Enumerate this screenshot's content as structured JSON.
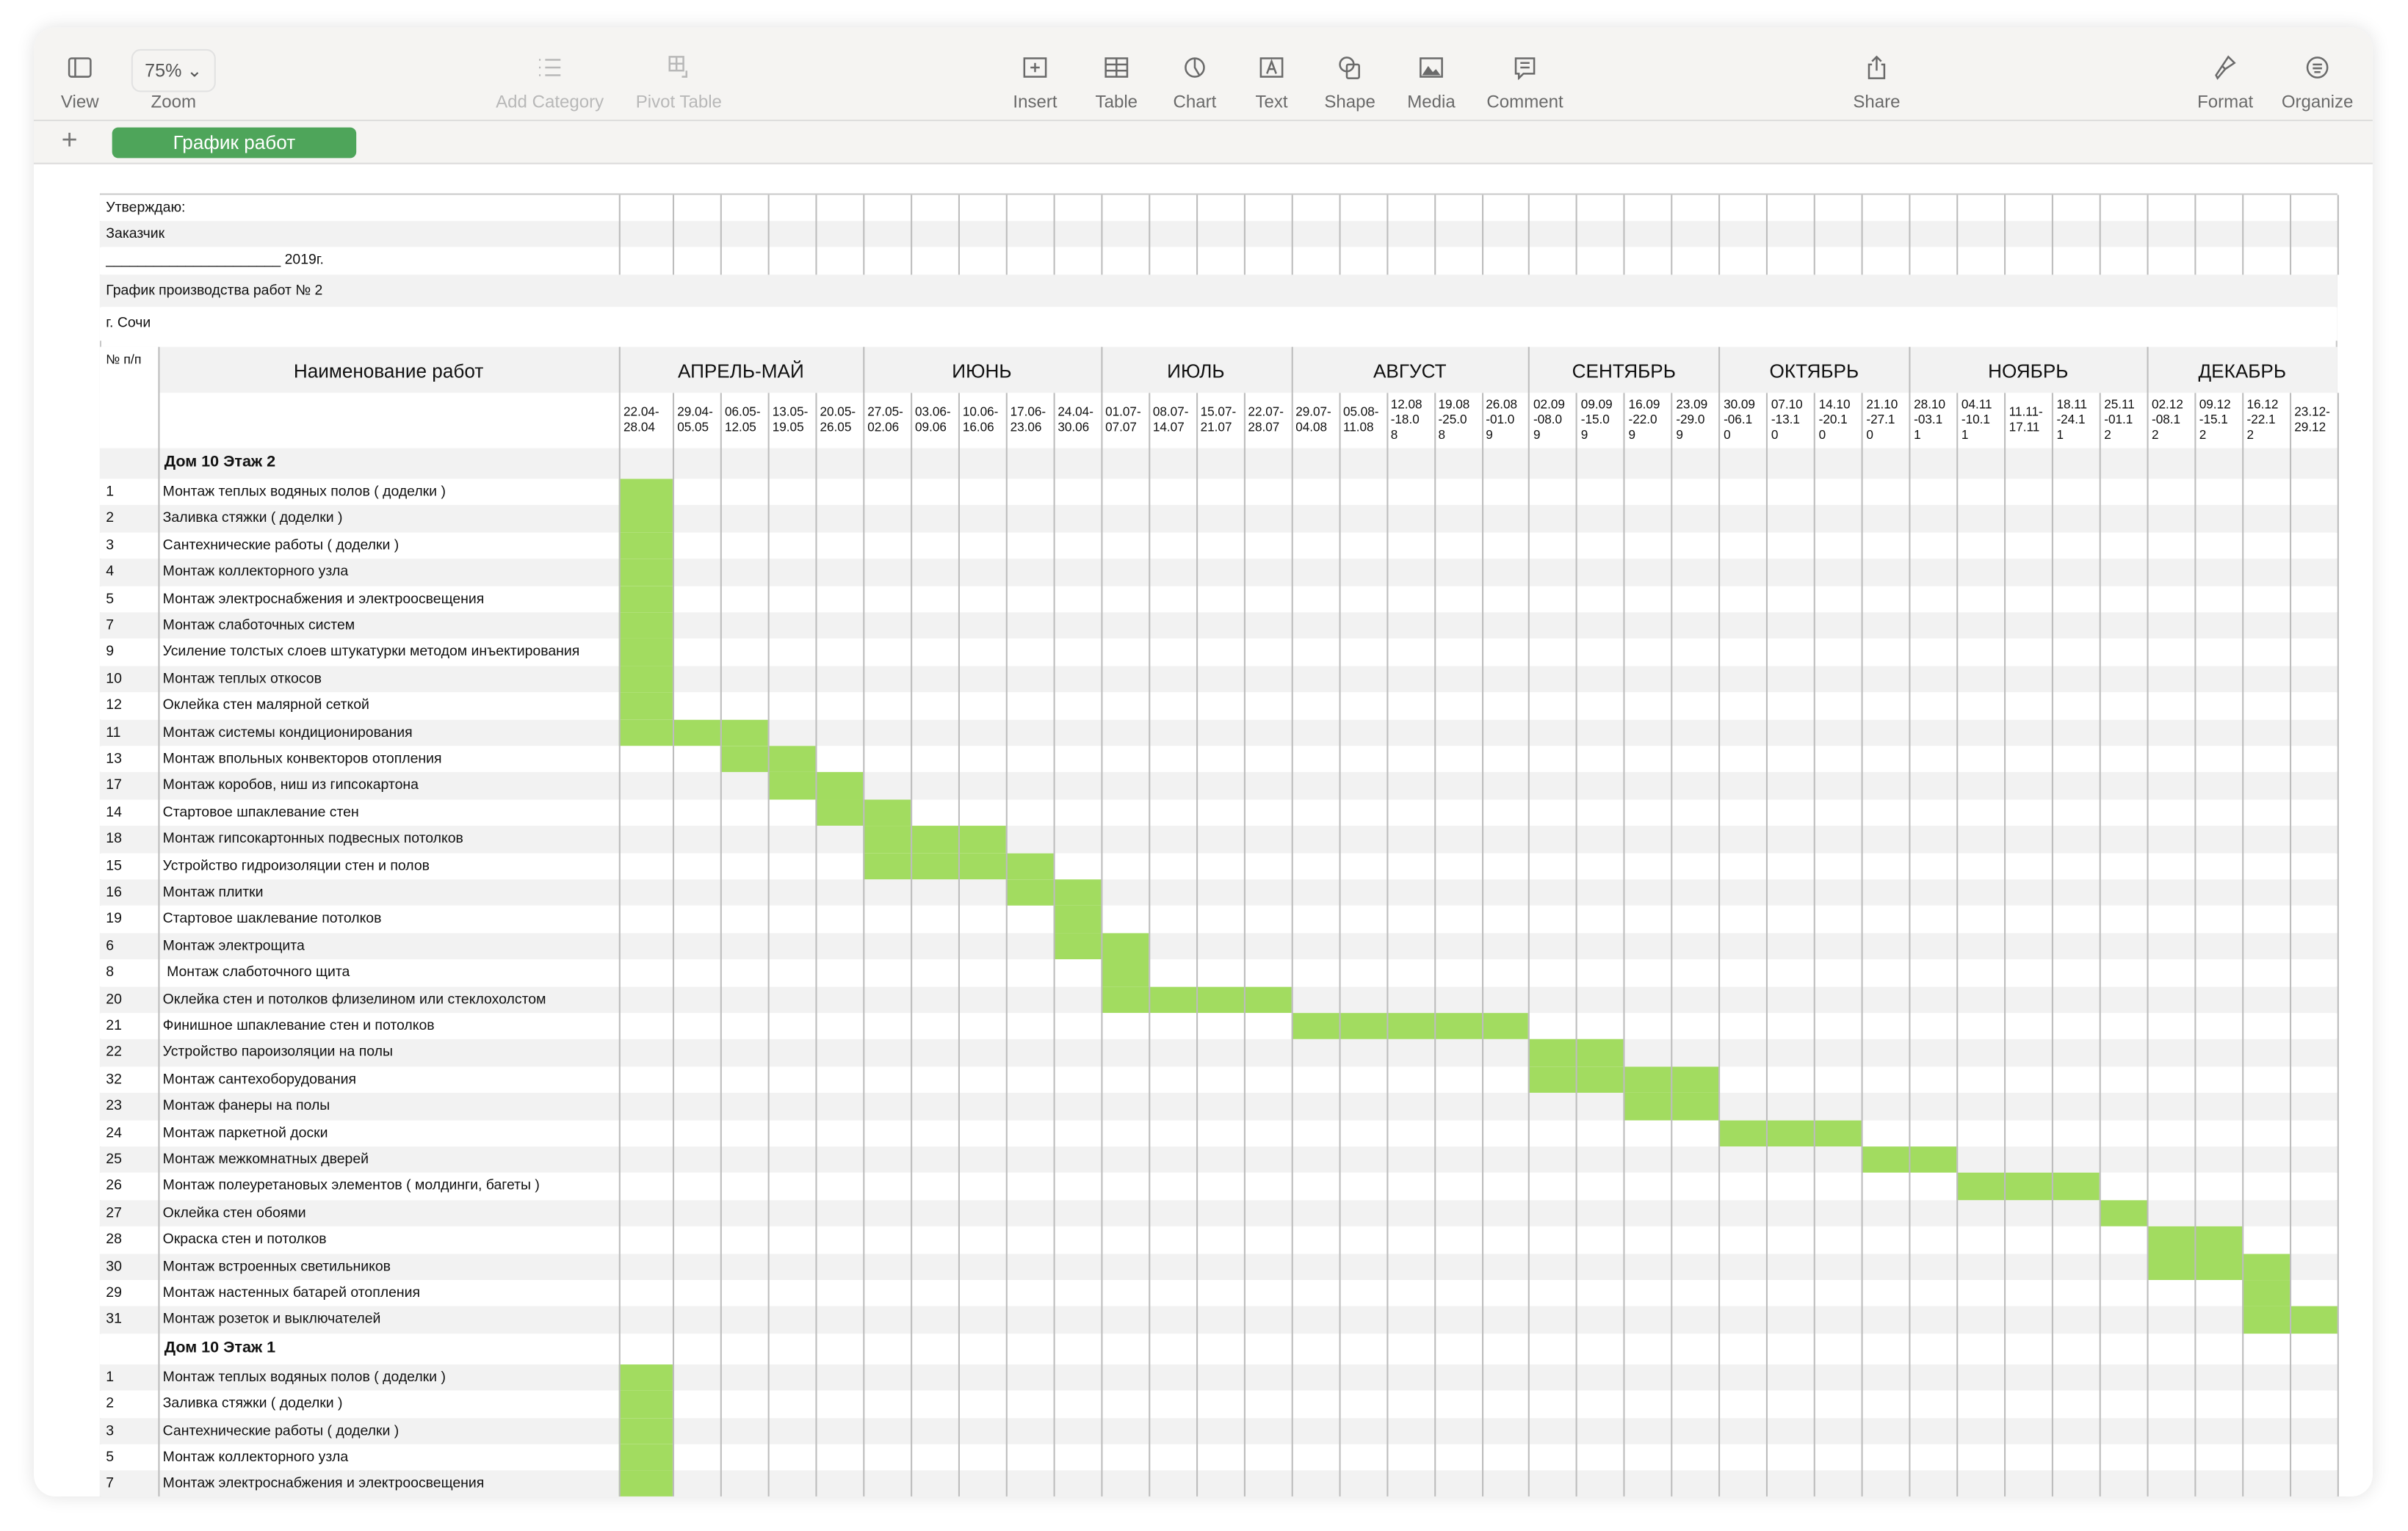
{
  "toolbar": {
    "zoom_value": "75%",
    "items": [
      {
        "label": "View",
        "icon": "sidebar-icon",
        "disabled": false
      },
      {
        "label": "Zoom",
        "icon": "zoom-menu",
        "disabled": false
      },
      {
        "label": "Add Category",
        "icon": "list-icon",
        "disabled": true
      },
      {
        "label": "Pivot Table",
        "icon": "pivot-table-icon",
        "disabled": true
      },
      {
        "label": "Insert",
        "icon": "insert-icon",
        "disabled": false
      },
      {
        "label": "Table",
        "icon": "table-icon",
        "disabled": false
      },
      {
        "label": "Chart",
        "icon": "chart-icon",
        "disabled": false
      },
      {
        "label": "Text",
        "icon": "text-icon",
        "disabled": false
      },
      {
        "label": "Shape",
        "icon": "shape-icon",
        "disabled": false
      },
      {
        "label": "Media",
        "icon": "media-icon",
        "disabled": false
      },
      {
        "label": "Comment",
        "icon": "comment-icon",
        "disabled": false
      },
      {
        "label": "Share",
        "icon": "share-icon",
        "disabled": false
      },
      {
        "label": "Format",
        "icon": "format-brush-icon",
        "disabled": false
      },
      {
        "label": "Organize",
        "icon": "organize-icon",
        "disabled": false
      }
    ]
  },
  "sheet_tab": "График работ",
  "add_sheet": "+",
  "colors": {
    "bar": "#a2dc60",
    "tab": "#4ea55a",
    "stripe": "#f2f2f2"
  },
  "doc": {
    "approve": "Утверждаю:",
    "customer": "Заказчик",
    "date_line": "______________________ 2019г.",
    "title": "График производства работ № 2",
    "city": "г. Сочи"
  },
  "table": {
    "col_no": "№ п/п",
    "col_name": "Наименование работ",
    "months": [
      {
        "name": "АПРЕЛЬ-МАЙ",
        "weeks": 5
      },
      {
        "name": "ИЮНЬ",
        "weeks": 5
      },
      {
        "name": "ИЮЛЬ",
        "weeks": 4
      },
      {
        "name": "АВГУСТ",
        "weeks": 5
      },
      {
        "name": "СЕНТЯБРЬ",
        "weeks": 4
      },
      {
        "name": "ОКТЯБРЬ",
        "weeks": 4
      },
      {
        "name": "НОЯБРЬ",
        "weeks": 5
      },
      {
        "name": "ДЕКАБРЬ",
        "weeks": 4
      }
    ],
    "weeks": [
      "22.04-\n28.04",
      "29.04-\n05.05",
      "06.05-\n12.05",
      "13.05-\n19.05",
      "20.05-\n26.05",
      "27.05-\n02.06",
      "03.06-\n09.06",
      "10.06-\n16.06",
      "17.06-\n23.06",
      "24.04-\n30.06",
      "01.07-\n07.07",
      "08.07-\n14.07",
      "15.07-\n21.07",
      "22.07-\n28.07",
      "29.07-\n04.08",
      "05.08-\n11.08",
      "12.08\n-18.0\n8",
      "19.08\n-25.0\n8",
      "26.08\n-01.0\n9",
      "02.09\n-08.0\n9",
      "09.09\n-15.0\n9",
      "16.09\n-22.0\n9",
      "23.09\n-29.0\n9",
      "30.09\n-06.1\n0",
      "07.10\n-13.1\n0",
      "14.10\n-20.1\n0",
      "21.10\n-27.1\n0",
      "28.10\n-03.1\n1",
      "04.11\n-10.1\n1",
      "11.11-\n17.11",
      "18.11\n-24.1\n1",
      "25.11\n-01.1\n2",
      "02.12\n-08.1\n2",
      "09.12\n-15.1\n2",
      "16.12\n-22.1\n2",
      "23.12-\n29.12"
    ],
    "sections": [
      {
        "title": "Дом 10 Этаж 2",
        "rows": [
          {
            "no": "1",
            "name": "Монтаж теплых водяных полов ( доделки )",
            "weeks": [
              0,
              0
            ]
          },
          {
            "no": "2",
            "name": "Заливка стяжки ( доделки )",
            "weeks": [
              0,
              0
            ]
          },
          {
            "no": "3",
            "name": "Сантехнические работы ( доделки )",
            "weeks": [
              0,
              0
            ]
          },
          {
            "no": "4",
            "name": "Монтаж коллекторного узла",
            "weeks": [
              0,
              0
            ]
          },
          {
            "no": "5",
            "name": "Монтаж электроснабжения и электроосвещения",
            "weeks": [
              0,
              0
            ]
          },
          {
            "no": "7",
            "name": "Монтаж слаботочных систем",
            "weeks": [
              0,
              0
            ]
          },
          {
            "no": "9",
            "name": "Усиление толстых слоев штукатурки методом инъектирования",
            "weeks": [
              0,
              0
            ]
          },
          {
            "no": "10",
            "name": "Монтаж теплых откосов",
            "weeks": [
              0,
              0
            ]
          },
          {
            "no": "12",
            "name": "Оклейка стен малярной сеткой",
            "weeks": [
              0,
              0
            ]
          },
          {
            "no": "11",
            "name": "Монтаж системы кондиционирования",
            "weeks": [
              0,
              2
            ]
          },
          {
            "no": "13",
            "name": "Монтаж впольных конвекторов отопления",
            "weeks": [
              2,
              3
            ]
          },
          {
            "no": "17",
            "name": "Монтаж коробов, ниш из гипсокартона",
            "weeks": [
              3,
              4
            ]
          },
          {
            "no": "14",
            "name": "Стартовое шпаклевание стен",
            "weeks": [
              4,
              5
            ]
          },
          {
            "no": "18",
            "name": "Монтаж гипсокартонных подвесных потолков",
            "weeks": [
              5,
              7
            ]
          },
          {
            "no": "15",
            "name": "Устройство гидроизоляции стен и полов",
            "weeks": [
              5,
              8
            ]
          },
          {
            "no": "16",
            "name": "Монтаж плитки",
            "weeks": [
              8,
              9
            ]
          },
          {
            "no": "19",
            "name": "Стартовое шаклевание потолков",
            "weeks": [
              9,
              9
            ]
          },
          {
            "no": "6",
            "name": "Монтаж электрощита",
            "weeks": [
              9,
              10
            ]
          },
          {
            "no": "8",
            "name": " Монтаж слаботочного щита",
            "weeks": [
              10,
              10
            ]
          },
          {
            "no": "20",
            "name": "Оклейка стен и потолков флизелином или стеклохолстом",
            "weeks": [
              10,
              13
            ]
          },
          {
            "no": "21",
            "name": "Финишное шпаклевание стен и потолков",
            "weeks": [
              14,
              18
            ]
          },
          {
            "no": "22",
            "name": "Устройство пароизоляции на полы",
            "weeks": [
              19,
              20
            ]
          },
          {
            "no": "32",
            "name": "Монтаж сантехоборудования",
            "weeks": [
              19,
              22
            ]
          },
          {
            "no": "23",
            "name": "Монтаж фанеры на полы",
            "weeks": [
              21,
              22
            ]
          },
          {
            "no": "24",
            "name": "Монтаж паркетной доски",
            "weeks": [
              23,
              25
            ]
          },
          {
            "no": "25",
            "name": "Монтаж межкомнатных дверей",
            "weeks": [
              26,
              27
            ]
          },
          {
            "no": "26",
            "name": "Монтаж полеуретановых элементов ( молдинги, багеты )",
            "weeks": [
              28,
              30
            ]
          },
          {
            "no": "27",
            "name": "Оклейка стен обоями",
            "weeks": [
              31,
              31
            ]
          },
          {
            "no": "28",
            "name": "Окраска стен и потолков",
            "weeks": [
              32,
              33
            ]
          },
          {
            "no": "30",
            "name": "Монтаж встроенных светильников",
            "weeks": [
              32,
              34
            ]
          },
          {
            "no": "29",
            "name": "Монтаж настенных батарей отопления",
            "weeks": [
              34,
              34
            ]
          },
          {
            "no": "31",
            "name": "Монтаж розеток и выключателей",
            "weeks": [
              34,
              35
            ]
          }
        ]
      },
      {
        "title": "Дом 10 Этаж 1",
        "rows": [
          {
            "no": "1",
            "name": "Монтаж теплых водяных полов ( доделки )",
            "weeks": [
              0,
              0
            ]
          },
          {
            "no": "2",
            "name": "Заливка стяжки ( доделки )",
            "weeks": [
              0,
              0
            ]
          },
          {
            "no": "3",
            "name": "Сантехнические работы ( доделки )",
            "weeks": [
              0,
              0
            ]
          },
          {
            "no": "5",
            "name": "Монтаж коллекторного узла",
            "weeks": [
              0,
              0
            ]
          },
          {
            "no": "7",
            "name": "Монтаж электроснабжения и электроосвещения",
            "weeks": [
              0,
              0
            ]
          }
        ]
      }
    ]
  }
}
